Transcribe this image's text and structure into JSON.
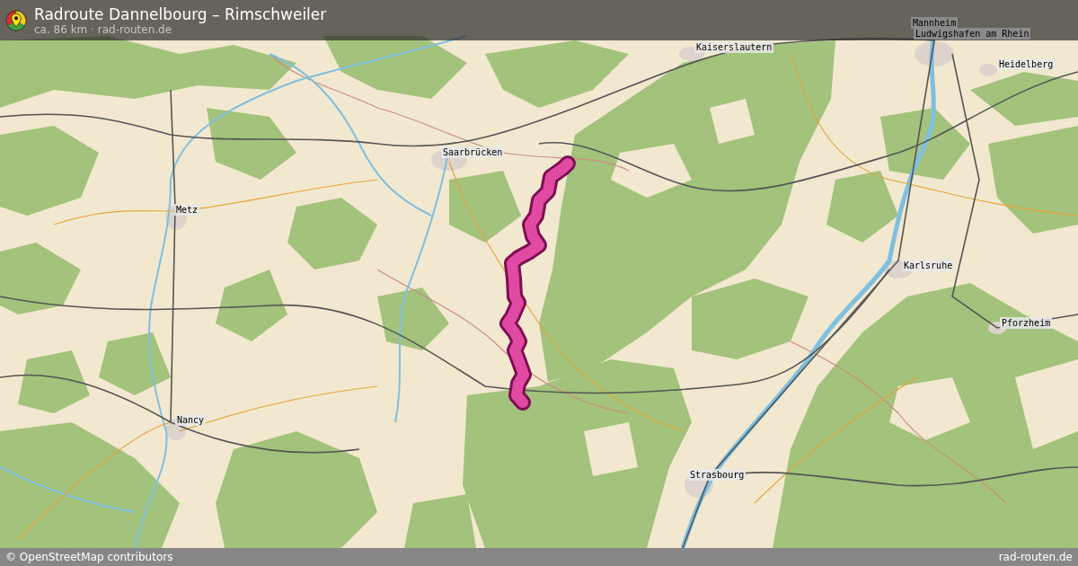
{
  "header": {
    "title": "Radroute Dannelbourg – Rimschweiler",
    "subtitle": "ca. 86 km · rad-routen.de"
  },
  "map": {
    "places": [
      {
        "name": "Mannheim"
      },
      {
        "name": "Ludwigshafen am Rhein"
      },
      {
        "name": "Kaiserslautern"
      },
      {
        "name": "Heidelberg"
      },
      {
        "name": "Saarbrücken"
      },
      {
        "name": "Metz"
      },
      {
        "name": "Karlsruhe"
      },
      {
        "name": "Pforzheim"
      },
      {
        "name": "Nancy"
      },
      {
        "name": "Strasbourg"
      }
    ]
  },
  "footer": {
    "attribution": "© OpenStreetMap contributors",
    "credit": "rad-routen.de"
  }
}
